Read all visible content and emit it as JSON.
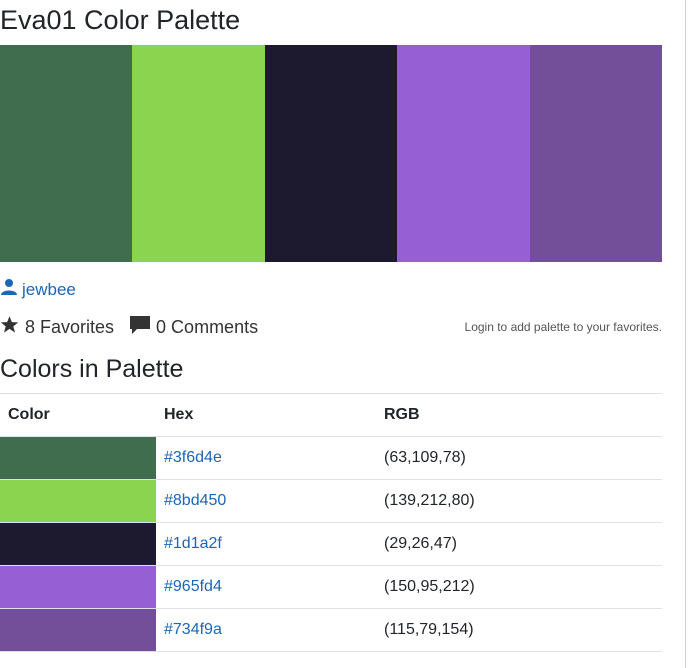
{
  "title": "Eva01 Color Palette",
  "palette": [
    {
      "hex": "#3f6d4e",
      "rgb": "(63,109,78)"
    },
    {
      "hex": "#8bd450",
      "rgb": "(139,212,80)"
    },
    {
      "hex": "#1d1a2f",
      "rgb": "(29,26,47)"
    },
    {
      "hex": "#965fd4",
      "rgb": "(150,95,212)"
    },
    {
      "hex": "#734f9a",
      "rgb": "(115,79,154)"
    }
  ],
  "author": {
    "icon": "user-icon",
    "name": "jewbee"
  },
  "stats": {
    "favorites_icon": "star-icon",
    "favorites": "8 Favorites",
    "comments_icon": "comment-icon",
    "comments": "0 Comments"
  },
  "login_note": "Login to add palette to your favorites.",
  "section_title": "Colors in Palette",
  "table": {
    "headers": [
      "Color",
      "Hex",
      "RGB"
    ]
  }
}
